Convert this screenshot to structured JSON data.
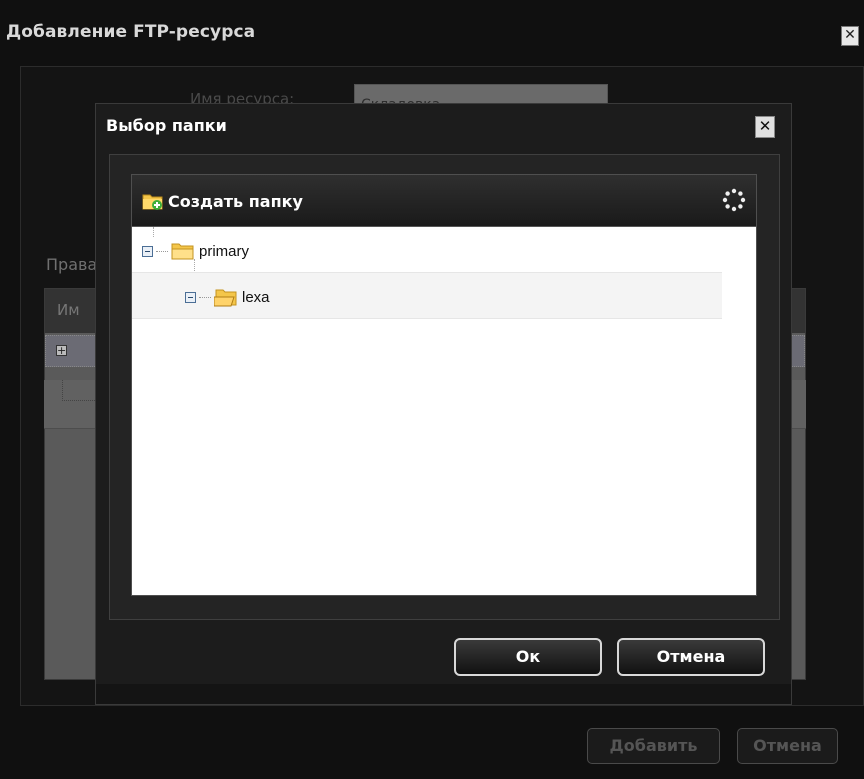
{
  "outer_dialog": {
    "title": "Добавление FTP-ресурса",
    "close_glyph": "✕",
    "resource_name_label": "Имя ресурса:",
    "resource_name_value": "Складовка",
    "rights_label": "Права",
    "rights_column": "Им",
    "add_button": "Добавить",
    "cancel_button": "Отмена"
  },
  "folder_dialog": {
    "title": "Выбор папки",
    "close_glyph": "✕",
    "create_folder_label": "Создать папку",
    "tree": [
      {
        "label": "primary",
        "expanded": true,
        "level": 0
      },
      {
        "label": "lexa",
        "expanded": true,
        "level": 1,
        "selected": true
      }
    ],
    "ok_button": "Ок",
    "cancel_button": "Отмена"
  },
  "icons": {
    "create_folder": "folder-plus-icon",
    "refresh": "refresh-icon",
    "tree_toggle": "minus-box-icon",
    "folder": "folder-icon"
  },
  "colors": {
    "folder_yellow": "#f4c64a",
    "accent_green": "#3fae3a"
  }
}
